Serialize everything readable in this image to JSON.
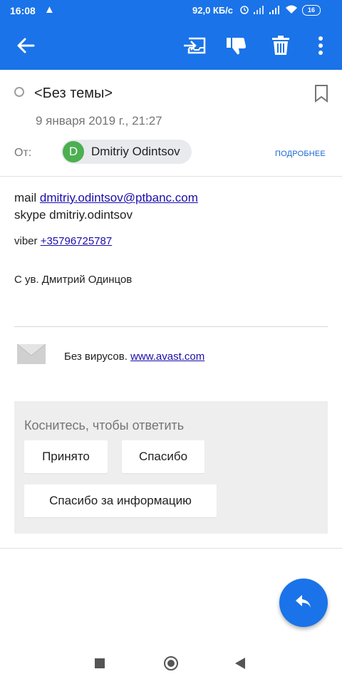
{
  "status_bar": {
    "time": "16:08",
    "warning_icon": "warning-icon",
    "net_speed": "92,0 КБ/с",
    "battery": "16"
  },
  "app_bar": {
    "color": "#1a73e8",
    "icons": [
      "back-arrow-icon",
      "move-to-inbox-icon",
      "spam-dislike-icon",
      "delete-icon",
      "more-vert-icon"
    ]
  },
  "email": {
    "subject": "<Без темы>",
    "date": "9 января 2019 г., 21:27",
    "from_label": "От:",
    "sender_initial": "D",
    "sender_name": "Dmitriy Odintsov",
    "details_link": "ПОДРОБНЕЕ",
    "body": {
      "mail_label": "mail ",
      "mail_address": "dmitriy.odintsov@ptbanc.com",
      "skype_line": "skype dmitriy.odintsov",
      "viber_label": "viber ",
      "viber_number": "+35796725787",
      "signature": "С ув. Дмитрий Одинцов"
    },
    "avast": {
      "text": "Без вирусов. ",
      "link": "www.avast.com"
    }
  },
  "quick_reply": {
    "hint": "Коснитесь, чтобы ответить",
    "options": [
      "Принято",
      "Спасибо",
      "Спасибо за информацию"
    ]
  },
  "fab": {
    "icon": "reply-icon"
  },
  "nav_bar": {
    "icons": [
      "recents-square-icon",
      "home-circle-icon",
      "back-triangle-icon"
    ]
  }
}
